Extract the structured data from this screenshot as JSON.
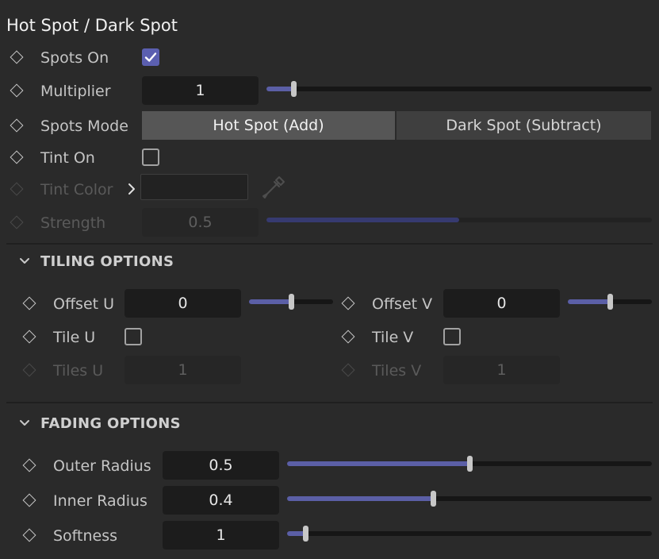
{
  "panel": {
    "title": "Hot Spot / Dark Spot"
  },
  "spots_on": {
    "label": "Spots On",
    "checked": true
  },
  "multiplier": {
    "label": "Multiplier",
    "value": "1",
    "level": 0.07
  },
  "spots_mode": {
    "label": "Spots Mode",
    "options": [
      "Hot Spot (Add)",
      "Dark Spot (Subtract)"
    ],
    "selected": "Hot Spot (Add)"
  },
  "tint_on": {
    "label": "Tint On",
    "checked": false
  },
  "tint_color": {
    "label": "Tint Color",
    "enabled": false
  },
  "strength": {
    "label": "Strength",
    "value": "0.5",
    "level": 0.5,
    "enabled": false
  },
  "tiling": {
    "header": "TILING OPTIONS",
    "offset_u": {
      "label": "Offset U",
      "value": "0",
      "level": 0.5
    },
    "offset_v": {
      "label": "Offset V",
      "value": "0",
      "level": 0.5
    },
    "tile_u": {
      "label": "Tile U",
      "checked": false
    },
    "tile_v": {
      "label": "Tile V",
      "checked": false
    },
    "tiles_u": {
      "label": "Tiles U",
      "value": "1",
      "enabled": false
    },
    "tiles_v": {
      "label": "Tiles V",
      "value": "1",
      "enabled": false
    }
  },
  "fading": {
    "header": "FADING OPTIONS",
    "outer_radius": {
      "label": "Outer Radius",
      "value": "0.5",
      "level": 0.5
    },
    "inner_radius": {
      "label": "Inner Radius",
      "value": "0.4",
      "level": 0.4
    },
    "softness": {
      "label": "Softness",
      "value": "1",
      "level": 0.05
    }
  },
  "colors": {
    "background": "#2a2a2a",
    "accent": "#5b5fa6",
    "field": "#1c1c1c",
    "segment_active": "#565656",
    "segment_inactive": "#3f3f3f"
  },
  "icons": [
    "keyframe-diamond-icon",
    "checkmark-icon",
    "chevron-right-icon",
    "eyedropper-icon",
    "chevron-down-icon"
  ]
}
